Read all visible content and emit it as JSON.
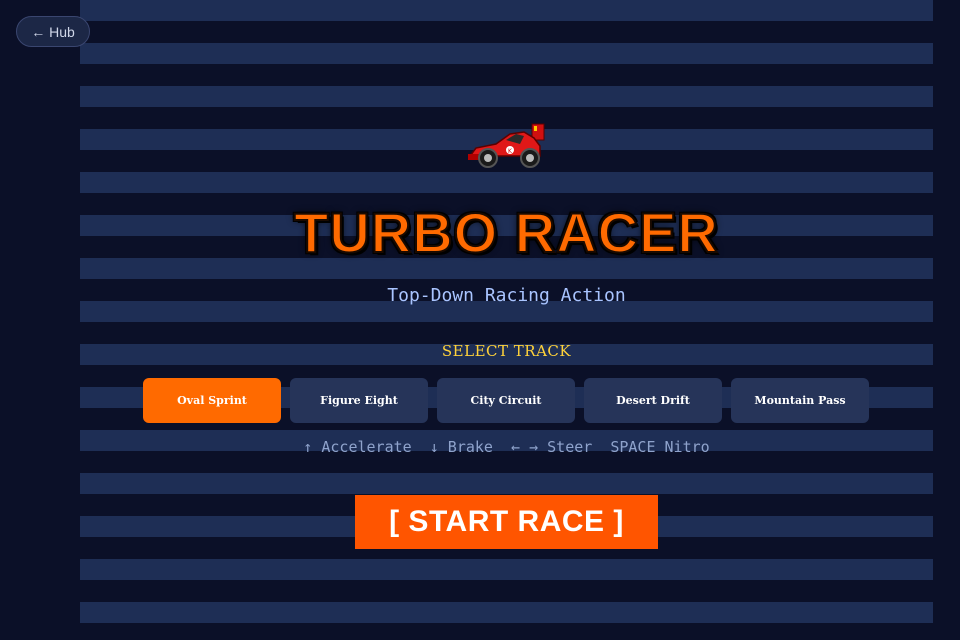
{
  "nav": {
    "hub_label": "← Hub"
  },
  "game": {
    "icon": "race-car-icon",
    "title": "TURBO RACER",
    "subtitle": "Top-Down Racing Action",
    "select_label": "SELECT TRACK",
    "tracks": [
      {
        "label": "Oval Sprint",
        "selected": true
      },
      {
        "label": "Figure Eight",
        "selected": false
      },
      {
        "label": "City Circuit",
        "selected": false
      },
      {
        "label": "Desert Drift",
        "selected": false
      },
      {
        "label": "Mountain Pass",
        "selected": false
      }
    ],
    "controls": "↑ Accelerate  ↓ Brake  ← → Steer  SPACE Nitro",
    "start_label": "[ START RACE ]"
  },
  "colors": {
    "accent": "#ff6a00",
    "start_button": "#ff5500",
    "select_label": "#ffd23a",
    "subtitle": "#a9c4ff",
    "track_button": "#263459",
    "background": "#0b1028",
    "stripe": "#1e2e55"
  }
}
